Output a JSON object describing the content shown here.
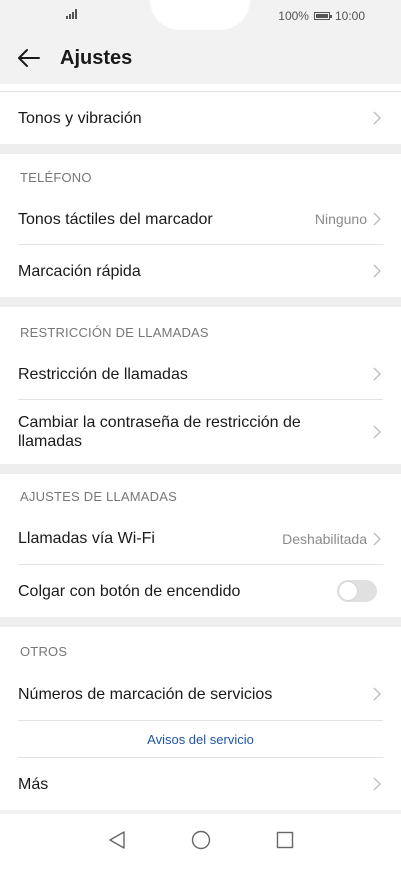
{
  "status": {
    "battery": "100%",
    "time": "10:00"
  },
  "header": {
    "title": "Ajustes"
  },
  "rows": {
    "tonos_vibracion": "Tonos y vibración",
    "tonos_tactiles": "Tonos táctiles del marcador",
    "tonos_tactiles_value": "Ninguno",
    "marcacion_rapida": "Marcación rápida",
    "restriccion": "Restricción de llamadas",
    "cambiar_contrasena": "Cambiar la contraseña de restricción de llamadas",
    "llamadas_wifi": "Llamadas vía Wi-Fi",
    "llamadas_wifi_value": "Deshabilitada",
    "colgar_boton": "Colgar con botón de encendido",
    "numeros_servicios": "Números de marcación de servicios",
    "avisos_servicio": "Avisos del servicio",
    "mas": "Más"
  },
  "sections": {
    "telefono": "TELÉFONO",
    "restriccion": "RESTRICCIÓN DE LLAMADAS",
    "ajustes_llamadas": "AJUSTES DE LLAMADAS",
    "otros": "OTROS"
  },
  "toggles": {
    "colgar_boton_on": false
  },
  "colors": {
    "link": "#1f55a5",
    "background": "#f2f2f2",
    "card": "#ffffff"
  },
  "icons": {
    "back": "arrow-left-icon",
    "chevron": "chevron-right-icon",
    "nav": [
      "back-triangle-icon",
      "home-circle-icon",
      "recents-square-icon"
    ]
  }
}
